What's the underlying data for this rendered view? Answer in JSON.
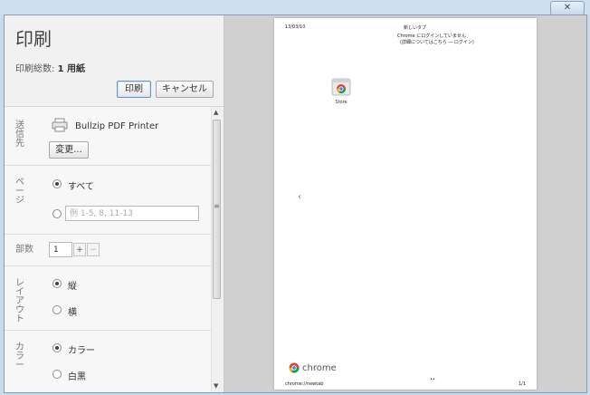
{
  "window": {
    "close_glyph": "✕"
  },
  "dialog": {
    "title": "印刷",
    "summary_label": "印刷総数: ",
    "summary_value": "1 用紙",
    "print_button": "印刷",
    "cancel_button": "キャンセル"
  },
  "destination": {
    "label": "送信先",
    "printer_name": "Bullzip PDF Printer",
    "change_button": "変更..."
  },
  "pages": {
    "label": "ページ",
    "all_option": "すべて",
    "range_placeholder": "例 1-5, 8, 11-13"
  },
  "copies": {
    "label": "部数",
    "value": "1",
    "plus": "+",
    "minus": "−"
  },
  "layout": {
    "label": "レイアウト",
    "portrait": "縦",
    "landscape": "横"
  },
  "color": {
    "label": "カラー",
    "color_option": "カラー",
    "bw_option": "白黒"
  },
  "scrollbar": {
    "up": "▲",
    "down": "▼",
    "grip": "≡"
  },
  "preview": {
    "date": "13/03/10",
    "page_title": "新しいタブ",
    "signin_line1": "Chrome にログインしていません",
    "signin_line2": "(詳細についてはこちら ― ログイン)",
    "app_label": "Store",
    "nav_arrow": "‹",
    "brand": "chrome",
    "footer_url": "chrome://newtab",
    "page_number": "1/1",
    "small_mark": "••"
  }
}
